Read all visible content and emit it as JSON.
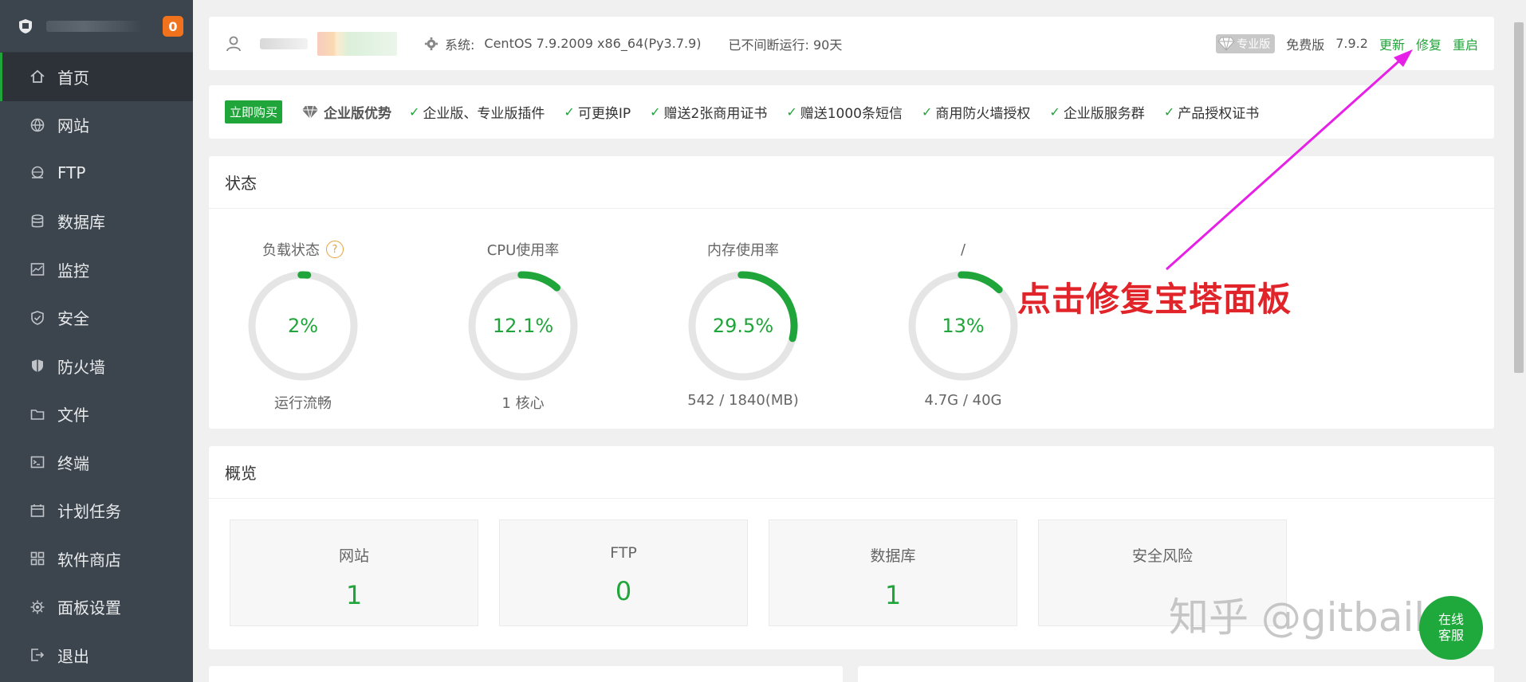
{
  "sidebar": {
    "badge": "0",
    "items": [
      {
        "label": "首页",
        "icon": "home-icon"
      },
      {
        "label": "网站",
        "icon": "globe-icon"
      },
      {
        "label": "FTP",
        "icon": "ftp-icon"
      },
      {
        "label": "数据库",
        "icon": "database-icon"
      },
      {
        "label": "监控",
        "icon": "monitor-icon"
      },
      {
        "label": "安全",
        "icon": "shield-check-icon"
      },
      {
        "label": "防火墙",
        "icon": "firewall-icon"
      },
      {
        "label": "文件",
        "icon": "folder-icon"
      },
      {
        "label": "终端",
        "icon": "terminal-icon"
      },
      {
        "label": "计划任务",
        "icon": "calendar-icon"
      },
      {
        "label": "软件商店",
        "icon": "apps-icon"
      },
      {
        "label": "面板设置",
        "icon": "gear-icon"
      },
      {
        "label": "退出",
        "icon": "logout-icon"
      }
    ]
  },
  "header": {
    "system_label": "系统:",
    "system_value": "CentOS 7.9.2009 x86_64(Py3.7.9)",
    "uptime": "已不间断运行: 90天",
    "pro_badge": "专业版",
    "edition": "免费版",
    "version": "7.9.2",
    "update": "更新",
    "repair": "修复",
    "restart": "重启"
  },
  "promo": {
    "buy": "立即购买",
    "title": "企业版优势",
    "items": [
      "企业版、专业版插件",
      "可更换IP",
      "赠送2张商用证书",
      "赠送1000条短信",
      "商用防火墙授权",
      "企业版服务群",
      "产品授权证书"
    ]
  },
  "status": {
    "title": "状态",
    "gauges": [
      {
        "label": "负载状态",
        "value": "2%",
        "percent": 2,
        "sub": "运行流畅"
      },
      {
        "label": "CPU使用率",
        "value": "12.1%",
        "percent": 12.1,
        "sub": "1 核心"
      },
      {
        "label": "内存使用率",
        "value": "29.5%",
        "percent": 29.5,
        "sub": "542 / 1840(MB)"
      },
      {
        "label": "/",
        "value": "13%",
        "percent": 13,
        "sub": "4.7G / 40G"
      }
    ]
  },
  "overview": {
    "title": "概览",
    "cards": [
      {
        "label": "网站",
        "value": "1"
      },
      {
        "label": "FTP",
        "value": "0"
      },
      {
        "label": "数据库",
        "value": "1"
      },
      {
        "label": "安全风险",
        "value": ""
      }
    ]
  },
  "annotation": "点击修复宝塔面板",
  "watermark": "知乎 @gitbaike",
  "chat": {
    "line1": "在线",
    "line2": "客服"
  },
  "colors": {
    "accent": "#20a53a",
    "sidebar": "#3c444d",
    "annotation": "#e0242a",
    "arrow": "#e620e6"
  }
}
